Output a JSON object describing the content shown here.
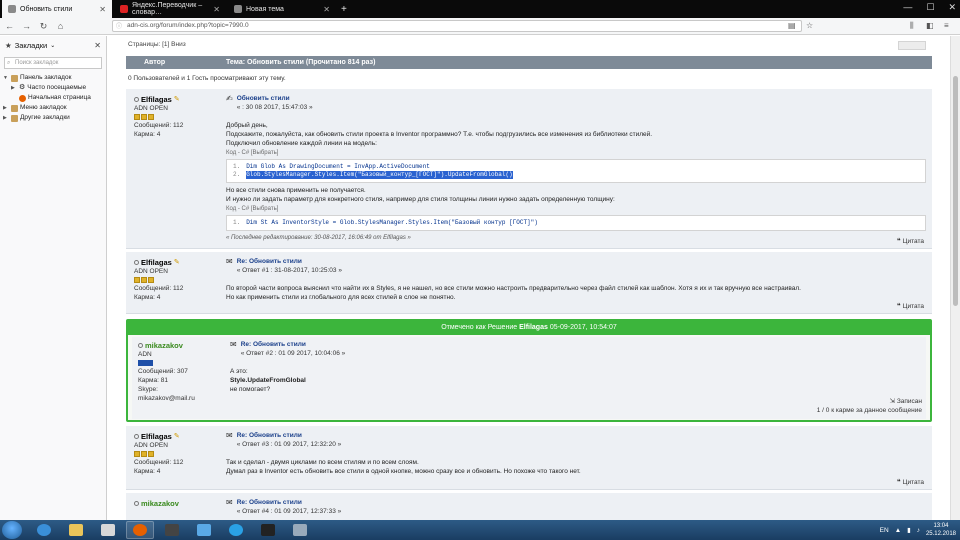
{
  "browser": {
    "tabs": [
      {
        "label": "Обновить стили"
      },
      {
        "label": "Яндекс.Переводчик – словар…"
      },
      {
        "label": "Новая тема"
      }
    ],
    "new_tab": "+",
    "url": "adn-cis.org/forum/index.php?topic=7990.0",
    "window_controls": {
      "min": "—",
      "max": "☐",
      "close": "✕"
    }
  },
  "sidebar": {
    "title": "Закладки",
    "search_placeholder": "Поиск закладок",
    "items": [
      {
        "label": "Панель закладок",
        "level": 0
      },
      {
        "label": "Часто посещаемые",
        "level": 1
      },
      {
        "label": "Начальная страница",
        "level": 1
      },
      {
        "label": "Меню закладок",
        "level": 0
      },
      {
        "label": "Другие закладки",
        "level": 0
      }
    ]
  },
  "forum": {
    "pagination": "Страницы: [1]  Вниз",
    "header_author": "Автор",
    "header_topic": "Тема: Обновить стили  (Прочитано 814 раз)",
    "viewers": "0 Пользователей и 1 Гость просматривают эту тему.",
    "quote_label": "Цитата",
    "posts": [
      {
        "author": "Elfilagas",
        "group": "ADN OPEN",
        "messages": "Сообщений: 112",
        "karma": "Карма: 4",
        "title": "Обновить стили",
        "meta": "« : 30 08 2017, 15:47:03 »",
        "lines": [
          "Добрый день,",
          "Подскажите, пожалуйста, как обновить стили проекта в Inventor программно? Т.е. чтобы подгрузились все изменения из библиотеки стилей.",
          "Подключил обновление каждой линии на модель:"
        ],
        "code_label": "Код - C# [Выбрать]",
        "code": [
          "Dim Glob As DrawingDocument = InvApp.ActiveDocument",
          "Glob.StylesManager.Styles.Item(\"Базовый_контур_[ГОСТ]\").UpdateFromGlobal()"
        ],
        "middle_lines": [
          "Но все стили снова применить не получается.",
          "И нужно ли задать параметр для конкретного стиля, например для стиля толщины линии нужно задать определенную толщину:"
        ],
        "code2_label": "Код - C# [Выбрать]",
        "code2": [
          "Dim St As InventorStyle = Glob.StylesManager.Styles.Item(\"Базовый контур [ГОСТ]\")"
        ],
        "last_edit": "« Последнее редактирование: 30-08-2017, 16:06:49 от Elfilagas »"
      },
      {
        "author": "Elfilagas",
        "group": "ADN OPEN",
        "messages": "Сообщений: 112",
        "karma": "Карма: 4",
        "title": "Re: Обновить стили",
        "meta": "« Ответ #1 : 31-08-2017, 10:25:03 »",
        "lines": [
          "По второй части вопроса выяснил что найти их в Styles, я не нашел, но все стили можно настроить предварительно через файл стилей как шаблон. Хотя я их и так вручную все настраивал.",
          "Но как применить стили из глобального для всех стилей в слое не понятно."
        ]
      },
      {
        "solution_banner": "Отмечено как Решение",
        "solution_by": "Elfilagas",
        "solution_date": "05-09-2017, 10:54:07",
        "author": "mikazakov",
        "group": "ADN",
        "messages": "Сообщений: 307",
        "karma": "Карма: 81",
        "skype_label": "Skype:",
        "skype": "mikazakov@mail.ru",
        "title": "Re: Обновить стили",
        "meta": "« Ответ #2 : 01 09 2017, 10:04:06 »",
        "lines": [
          "А это:",
          "Style.UpdateFromGlobal",
          "не помогает?"
        ],
        "footer_action": "Записан",
        "footer_note": "1 / 0 к карме за данное сообщение"
      },
      {
        "author": "Elfilagas",
        "group": "ADN OPEN",
        "messages": "Сообщений: 112",
        "karma": "Карма: 4",
        "title": "Re: Обновить стили",
        "meta": "« Ответ #3 : 01 09 2017, 12:32:20 »",
        "lines": [
          "Так и сделал - двумя циклами по всем стилям и по всем слоям.",
          "Думал раз в Inventor есть обновить все стили в одной кнопке, можно сразу все и обновить. Но похоже что такого нет."
        ]
      },
      {
        "author": "mikazakov",
        "title": "Re: Обновить стили",
        "meta": "« Ответ #4 : 01 09 2017, 12:37:33 »"
      }
    ]
  },
  "taskbar": {
    "lang": "EN",
    "time": "13:04",
    "date": "25.12.2018"
  },
  "colors": {
    "solution_green": "#3cb53c",
    "header_gray": "#7e8a97",
    "post_bg": "#edf0f4",
    "link_blue": "#1a3f8a"
  }
}
